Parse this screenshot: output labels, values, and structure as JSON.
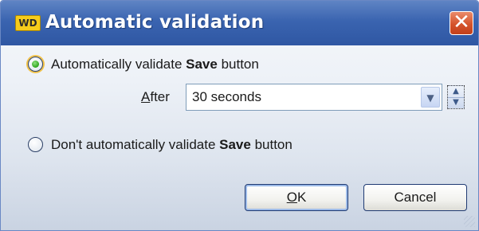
{
  "window": {
    "logo_text": "WD",
    "title": "Automatic validation",
    "close_glyph": "✕"
  },
  "options": {
    "auto": {
      "prefix": "Automatically validate ",
      "bold": "Save",
      "suffix": " button",
      "checked": true
    },
    "manual": {
      "prefix": "Don't automatically  validate ",
      "bold": "Save",
      "suffix": " button",
      "checked": false
    }
  },
  "after": {
    "label_accel": "A",
    "label_rest": "fter",
    "value": "30 seconds",
    "dropdown_icon": "chevron-down-icon",
    "spin_icons": [
      "spin-up-icon",
      "spin-down-icon"
    ]
  },
  "buttons": {
    "ok_accel": "O",
    "ok_rest": "K",
    "cancel": "Cancel"
  },
  "colors": {
    "titlebar": "#3a64b0",
    "close": "#d5542c",
    "radio_checked": "#2ea51c"
  }
}
